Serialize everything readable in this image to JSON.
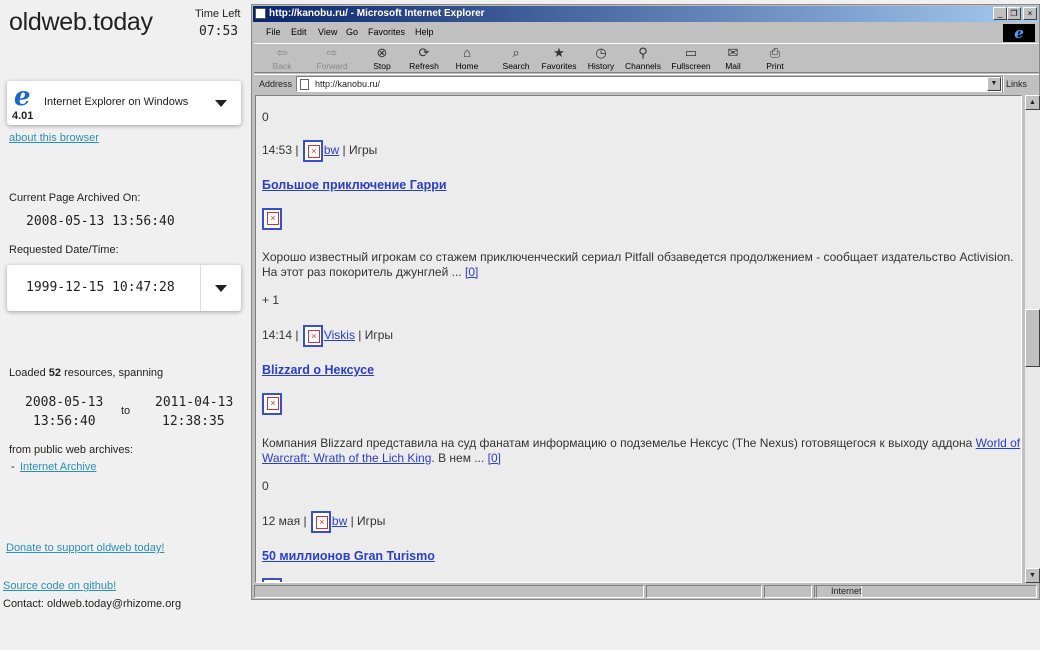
{
  "sidebar": {
    "logo": "oldweb.today",
    "time_left_label": "Time Left",
    "time_left_value": "07:53",
    "browser": {
      "name": "Internet Explorer on Windows",
      "version": "4.01"
    },
    "about_link": "about this browser",
    "archived_label": "Current Page Archived On:",
    "archived_value": "2008-05-13 13:56:40",
    "requested_label": "Requested Date/Time:",
    "requested_value": "1999-12-15 10:47:28",
    "loaded_prefix": "Loaded",
    "loaded_count": "52",
    "loaded_suffix": "resources, spanning",
    "span_from_date": "2008-05-13",
    "span_from_time": "13:56:40",
    "span_to_word": "to",
    "span_to_date": "2011-04-13",
    "span_to_time": "12:38:35",
    "archives_label": "from public web archives:",
    "archive_bullet": "-",
    "archive_link": "Internet Archive",
    "donate_link": "Donate to support oldweb today!",
    "source_link": "Source code on github!",
    "contact": "Contact: oldweb.today@rhizome.org"
  },
  "ie": {
    "title": "http://kanobu.ru/ - Microsoft Internet Explorer",
    "window_buttons": [
      "_",
      "❐",
      "×"
    ],
    "menu": [
      "File",
      "Edit",
      "View",
      "Go",
      "Favorites",
      "Help"
    ],
    "toolbar": [
      {
        "label": "Back",
        "icon": "back-arrow-icon",
        "glyph": "⇦",
        "disabled": true
      },
      {
        "label": "Forward",
        "icon": "forward-arrow-icon",
        "glyph": "⇨",
        "disabled": true
      },
      {
        "label": "Stop",
        "icon": "stop-icon",
        "glyph": "⊗",
        "disabled": false
      },
      {
        "label": "Refresh",
        "icon": "refresh-icon",
        "glyph": "⟳",
        "disabled": false
      },
      {
        "label": "Home",
        "icon": "home-icon",
        "glyph": "⌂",
        "disabled": false
      },
      {
        "label": "Search",
        "icon": "search-icon",
        "glyph": "⌕",
        "disabled": false
      },
      {
        "label": "Favorites",
        "icon": "favorites-icon",
        "glyph": "★",
        "disabled": false
      },
      {
        "label": "History",
        "icon": "history-icon",
        "glyph": "◷",
        "disabled": false
      },
      {
        "label": "Channels",
        "icon": "channels-icon",
        "glyph": "⚲",
        "disabled": false
      },
      {
        "label": "Fullscreen",
        "icon": "fullscreen-icon",
        "glyph": "▭",
        "disabled": false
      },
      {
        "label": "Mail",
        "icon": "mail-icon",
        "glyph": "✉",
        "disabled": false
      },
      {
        "label": "Print",
        "icon": "print-icon",
        "glyph": "⎙",
        "disabled": false
      }
    ],
    "address_label": "Address",
    "address_value": "http://kanobu.ru/",
    "links_label": "Links",
    "status_zone": "Internet"
  },
  "content": {
    "count_top": "0",
    "meta1_time": "14:53 |",
    "meta1_user": "bw",
    "meta1_cat": "| Игры",
    "h1": "Большое приключение Гарри",
    "p1": "Хорошо известный игрокам со стажем приключенческий сериал Pitfall обзаведется продолжением - сообщает издательство Activision. На этот раз покоритель джунглей ...",
    "more": "[0]",
    "plus": "+ 1",
    "meta2_time": "14:14 |",
    "meta2_user": "Viskis",
    "meta2_cat": "| Игры",
    "h2": "Blizzard о Нексусе",
    "p2_start": "Компания Blizzard представила на суд фанатам информацию о подземелье Нексус (The Nexus) готовящегося к выходу аддона",
    "p2_link": "World of Warcraft: Wrath of the Lich King",
    "p2_end": ". В нем ...",
    "count_mid": "0",
    "meta3_time": "12 мая |",
    "meta3_user": "bw",
    "meta3_cat": "| Игры",
    "h3": "50 миллионов Gran Turismo"
  }
}
